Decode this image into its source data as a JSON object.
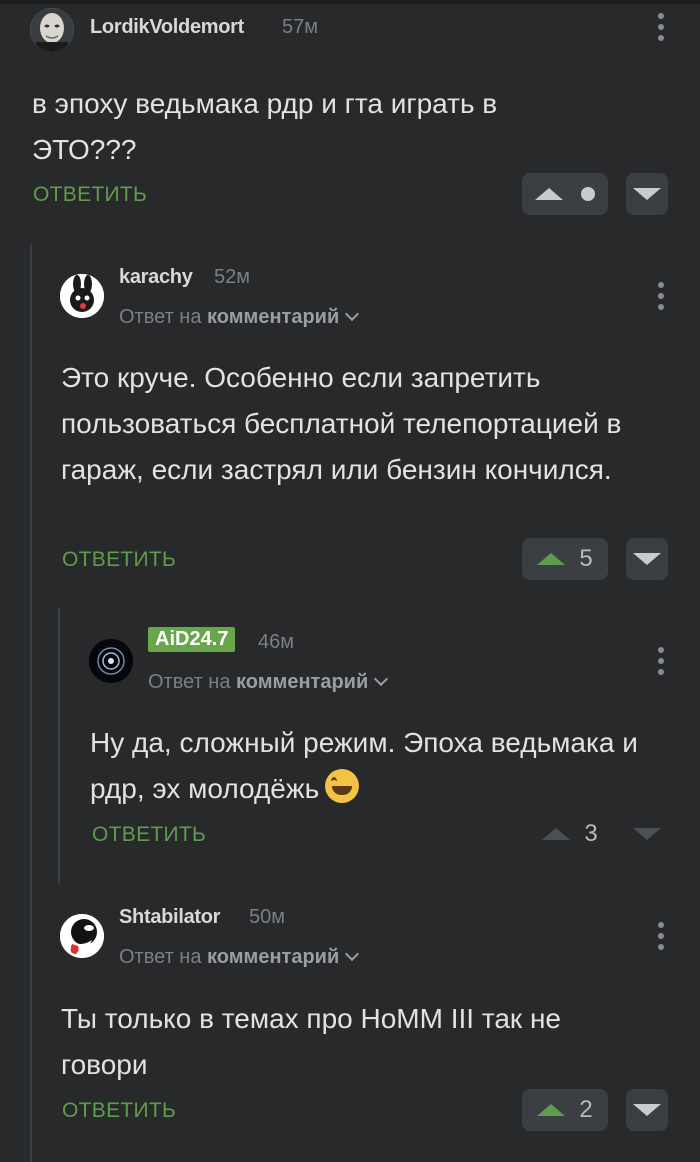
{
  "comments": [
    {
      "author": "LordikVoldemort",
      "time": "57м",
      "text": "в эпоху ведьмака рдр и гта играть в ЭТО???",
      "reply": "ОТВЕТИТЬ",
      "avatar_icon": "voldemort-avatar"
    },
    {
      "author": "karachy",
      "time": "52м",
      "reply_prefix": "Ответ на",
      "reply_target": "комментарий",
      "text": "Это круче. Особенно если запретить пользоваться бесплатной телепортацией в гараж, если застрял или бензин кончился.",
      "reply": "ОТВЕТИТЬ",
      "score": "5",
      "avatar_icon": "bunny-avatar"
    },
    {
      "author": "AiD24.7",
      "time": "46м",
      "reply_prefix": "Ответ на",
      "reply_target": "комментарий",
      "text": "Ну да, сложный режим. Эпоха ведьмака и рдр, эх молодёжь",
      "reply": "ОТВЕТИТЬ",
      "score": "3",
      "avatar_icon": "galaxy-avatar",
      "badge_color": "#67a64a"
    },
    {
      "author": "Shtabilator",
      "time": "50м",
      "reply_prefix": "Ответ на",
      "reply_target": "комментарий",
      "text": "Ты только в темах про HoMM III так не говори",
      "reply": "ОТВЕТИТЬ",
      "score": "2",
      "avatar_icon": "trollface-avatar"
    }
  ],
  "colors": {
    "accent": "#5e9d4b",
    "background": "#27292b",
    "vote_bg": "#3b3e42"
  }
}
